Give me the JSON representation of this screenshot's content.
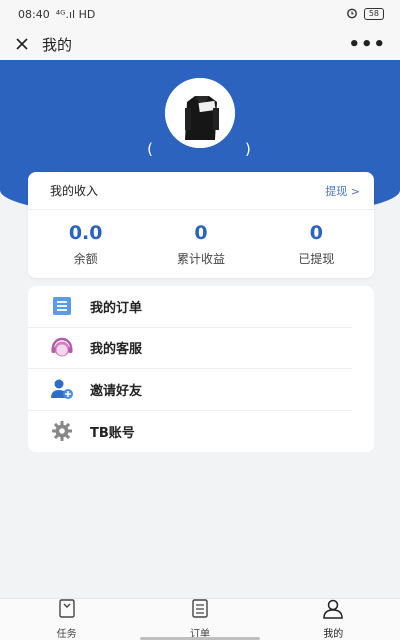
{
  "status_bar": {
    "time": "08:40",
    "network": "⁴ᴳ.ıl HD",
    "battery": "58"
  },
  "nav": {
    "title": "我的",
    "more": "•••"
  },
  "profile": {
    "paren_open": "(",
    "paren_close": ")"
  },
  "income": {
    "title": "我的收入",
    "withdraw_link": "提现 >",
    "stats": [
      {
        "value": "0.0",
        "label": "余额"
      },
      {
        "value": "0",
        "label": "累计收益"
      },
      {
        "value": "0",
        "label": "已提现"
      }
    ]
  },
  "menu": [
    {
      "label": "我的订单",
      "icon": "order-list-icon"
    },
    {
      "label": "我的客服",
      "icon": "customer-service-icon"
    },
    {
      "label": "邀请好友",
      "icon": "invite-friend-icon"
    },
    {
      "label": "TB账号",
      "icon": "gear-icon"
    }
  ],
  "tabs": [
    {
      "label": "任务",
      "icon": "task-icon"
    },
    {
      "label": "订单",
      "icon": "order-icon"
    },
    {
      "label": "我的",
      "icon": "profile-icon",
      "active": true
    }
  ],
  "colors": {
    "brand_blue": "#2b63bf",
    "link_blue": "#4a76c9",
    "background": "#f2f3f5"
  }
}
